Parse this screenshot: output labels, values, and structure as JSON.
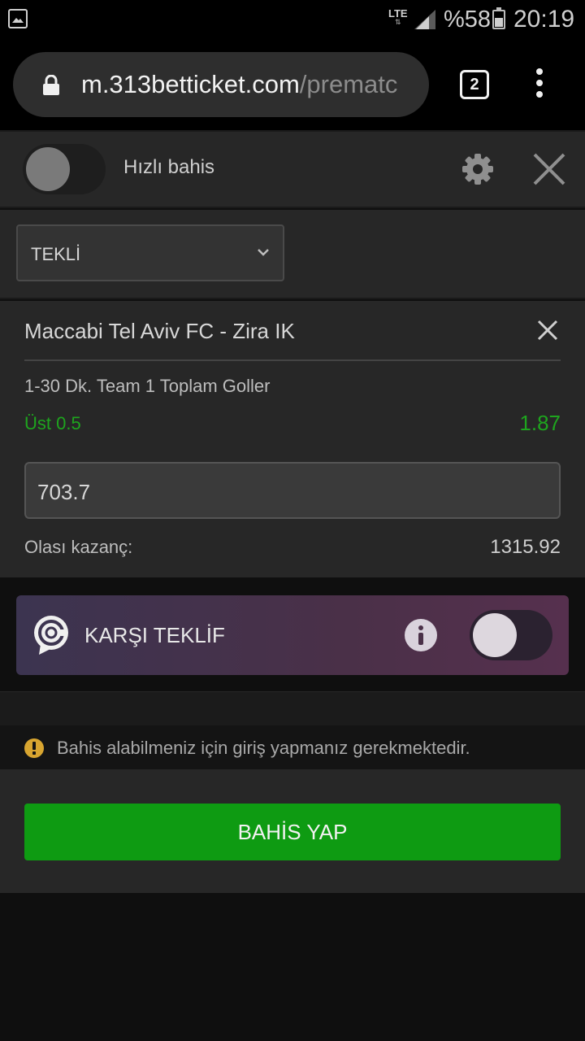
{
  "status_bar": {
    "network": "LTE",
    "battery": "%58",
    "time": "20:19",
    "icons": [
      "gallery-icon",
      "signal-icon",
      "battery-icon"
    ]
  },
  "browser": {
    "url_host": "m.313betticket.com",
    "url_path": "/prematc",
    "tab_count": "2",
    "icons": [
      "lock-icon",
      "menu-dots-icon"
    ]
  },
  "header": {
    "quick_bet_label": "Hızlı bahis",
    "quick_bet_enabled": false,
    "icons": [
      "gear-icon",
      "close-icon"
    ]
  },
  "bet_type": {
    "selected": "TEKLİ"
  },
  "bet": {
    "match": "Maccabi Tel Aviv FC - Zira IK",
    "market": "1-30 Dk. Team 1 Toplam Goller",
    "selection": "Üst 0.5",
    "odds": "1.87",
    "stake": "703.7",
    "potential_win_label": "Olası kazanç:",
    "potential_win_value": "1315.92"
  },
  "counter_offer": {
    "label": "KARŞI TEKLİF",
    "enabled": false,
    "icons": [
      "counter-offer-logo-icon",
      "info-icon"
    ]
  },
  "warning": {
    "text": "Bahis alabilmeniz için giriş yapmanız gerekmektedir."
  },
  "action": {
    "place_bet_label": "BAHİS YAP"
  },
  "colors": {
    "accent_green": "#0e9b12",
    "odds_green": "#1ea51e",
    "panel": "#272727",
    "background": "#0f0f0f",
    "warning": "#d8a530"
  }
}
